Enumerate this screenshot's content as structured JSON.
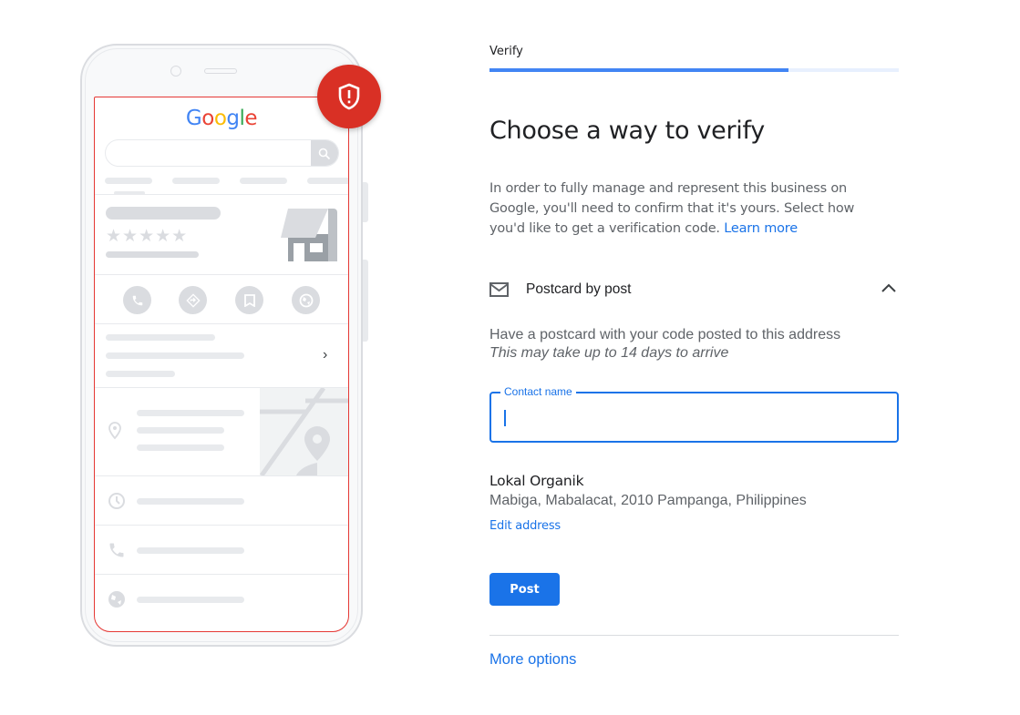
{
  "illustration": {
    "logo_letters": [
      "G",
      "o",
      "o",
      "g",
      "l",
      "e"
    ],
    "stars": "★★★★★",
    "chevron": "›",
    "alert_icon": "shield-alert-icon"
  },
  "header": {
    "step_label": "Verify",
    "progress_percent": 73
  },
  "main": {
    "title": "Choose a way to verify",
    "intro": "In order to fully manage and represent this business on Google, you'll need to confirm that it's yours. Select how you'd like to get a verification code.",
    "learn_more": "Learn more",
    "method": {
      "icon": "mail-icon",
      "label": "Postcard by post",
      "expanded": true,
      "description": "Have a postcard with your code posted to this address",
      "note": "This may take up to 14 days to arrive"
    },
    "contact_field": {
      "label": "Contact name",
      "value": "",
      "placeholder": ""
    },
    "business": {
      "name": "Lokal Organik",
      "address": "Mabiga, Mabalacat, 2010 Pampanga, Philippines",
      "edit_label": "Edit address"
    },
    "post_button": "Post",
    "more_options": "More options"
  },
  "colors": {
    "accent": "#1a73e8",
    "alert": "#d93025",
    "progress": "#4285f4"
  }
}
